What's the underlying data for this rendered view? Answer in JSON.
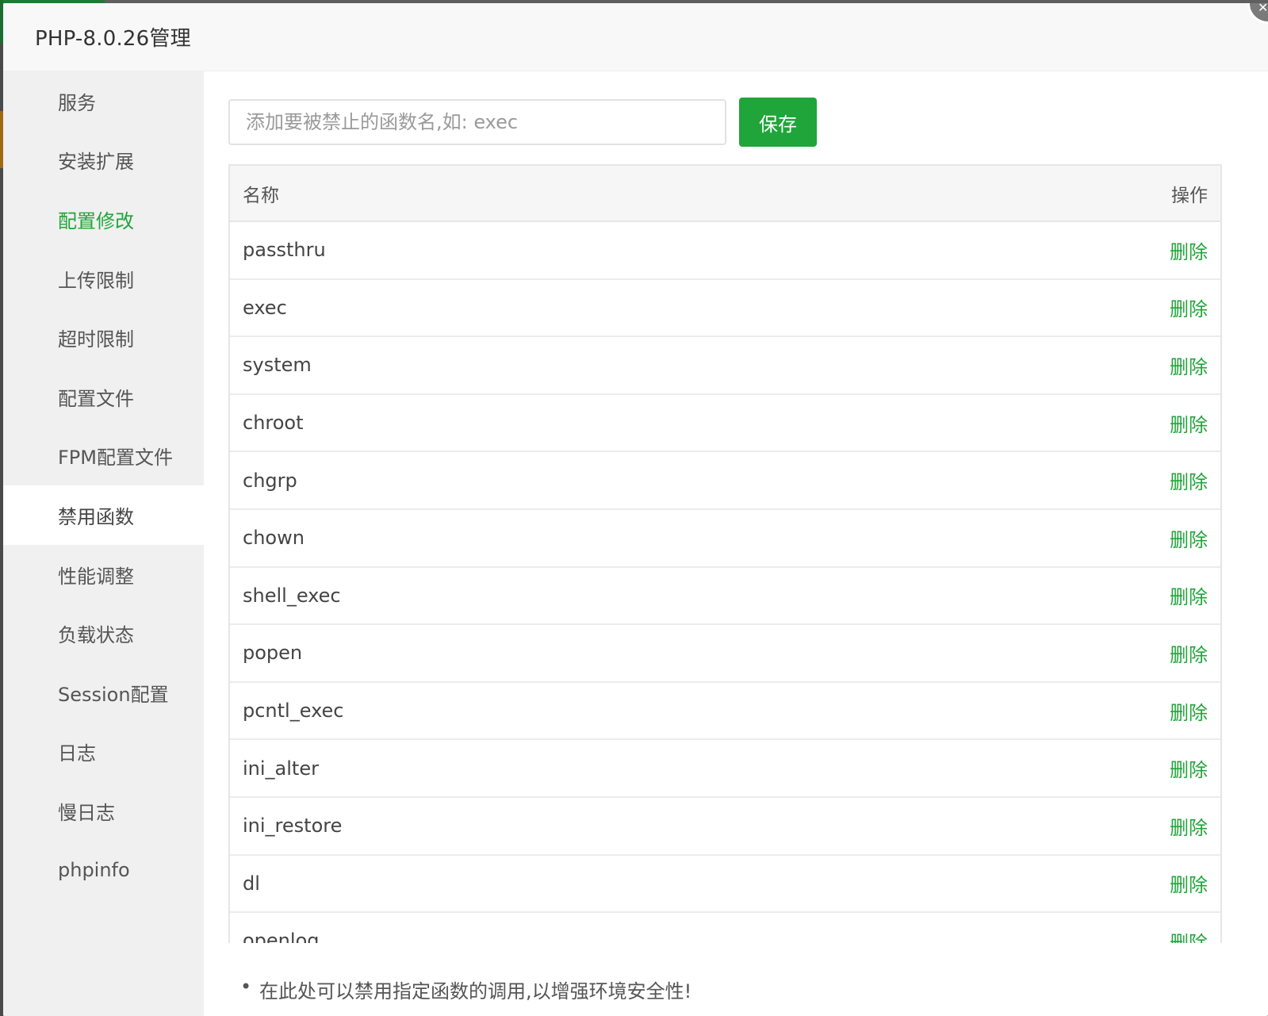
{
  "dialog": {
    "title": "PHP-8.0.26管理"
  },
  "sidebar": {
    "items": [
      {
        "label": "服务",
        "state": "normal"
      },
      {
        "label": "安装扩展",
        "state": "normal"
      },
      {
        "label": "配置修改",
        "state": "green"
      },
      {
        "label": "上传限制",
        "state": "normal"
      },
      {
        "label": "超时限制",
        "state": "normal"
      },
      {
        "label": "配置文件",
        "state": "normal"
      },
      {
        "label": "FPM配置文件",
        "state": "normal"
      },
      {
        "label": "禁用函数",
        "state": "active"
      },
      {
        "label": "性能调整",
        "state": "normal"
      },
      {
        "label": "负载状态",
        "state": "normal"
      },
      {
        "label": "Session配置",
        "state": "normal"
      },
      {
        "label": "日志",
        "state": "normal"
      },
      {
        "label": "慢日志",
        "state": "normal"
      },
      {
        "label": "phpinfo",
        "state": "normal"
      }
    ]
  },
  "toolbar": {
    "input_placeholder": "添加要被禁止的函数名,如: exec",
    "input_value": "",
    "save_label": "保存"
  },
  "table": {
    "headers": {
      "name": "名称",
      "action": "操作"
    },
    "delete_label": "删除",
    "rows": [
      "passthru",
      "exec",
      "system",
      "chroot",
      "chgrp",
      "chown",
      "shell_exec",
      "popen",
      "pcntl_exec",
      "ini_alter",
      "ini_restore",
      "dl",
      "openlog"
    ]
  },
  "tips": {
    "text": "在此处可以禁用指定函数的调用,以增强环境安全性!"
  },
  "colors": {
    "accent": "#20a53a",
    "sidebar_bg": "#f0f0f0",
    "header_bg": "#f8f8f8"
  }
}
